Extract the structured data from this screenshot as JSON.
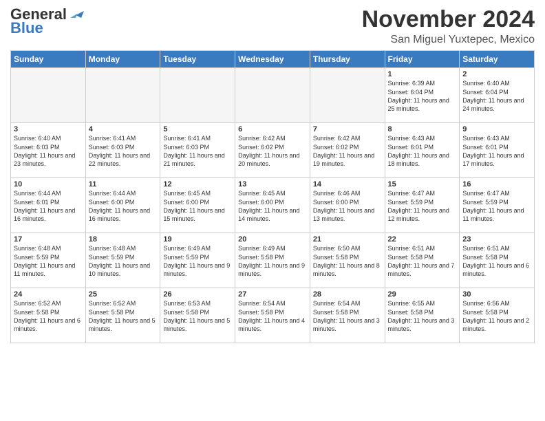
{
  "header": {
    "logo_general": "General",
    "logo_blue": "Blue",
    "month": "November 2024",
    "location": "San Miguel Yuxtepec, Mexico"
  },
  "days_of_week": [
    "Sunday",
    "Monday",
    "Tuesday",
    "Wednesday",
    "Thursday",
    "Friday",
    "Saturday"
  ],
  "weeks": [
    [
      {
        "day": "",
        "empty": true
      },
      {
        "day": "",
        "empty": true
      },
      {
        "day": "",
        "empty": true
      },
      {
        "day": "",
        "empty": true
      },
      {
        "day": "",
        "empty": true
      },
      {
        "day": "1",
        "sunrise": "Sunrise: 6:39 AM",
        "sunset": "Sunset: 6:04 PM",
        "daylight": "Daylight: 11 hours and 25 minutes."
      },
      {
        "day": "2",
        "sunrise": "Sunrise: 6:40 AM",
        "sunset": "Sunset: 6:04 PM",
        "daylight": "Daylight: 11 hours and 24 minutes."
      }
    ],
    [
      {
        "day": "3",
        "sunrise": "Sunrise: 6:40 AM",
        "sunset": "Sunset: 6:03 PM",
        "daylight": "Daylight: 11 hours and 23 minutes."
      },
      {
        "day": "4",
        "sunrise": "Sunrise: 6:41 AM",
        "sunset": "Sunset: 6:03 PM",
        "daylight": "Daylight: 11 hours and 22 minutes."
      },
      {
        "day": "5",
        "sunrise": "Sunrise: 6:41 AM",
        "sunset": "Sunset: 6:03 PM",
        "daylight": "Daylight: 11 hours and 21 minutes."
      },
      {
        "day": "6",
        "sunrise": "Sunrise: 6:42 AM",
        "sunset": "Sunset: 6:02 PM",
        "daylight": "Daylight: 11 hours and 20 minutes."
      },
      {
        "day": "7",
        "sunrise": "Sunrise: 6:42 AM",
        "sunset": "Sunset: 6:02 PM",
        "daylight": "Daylight: 11 hours and 19 minutes."
      },
      {
        "day": "8",
        "sunrise": "Sunrise: 6:43 AM",
        "sunset": "Sunset: 6:01 PM",
        "daylight": "Daylight: 11 hours and 18 minutes."
      },
      {
        "day": "9",
        "sunrise": "Sunrise: 6:43 AM",
        "sunset": "Sunset: 6:01 PM",
        "daylight": "Daylight: 11 hours and 17 minutes."
      }
    ],
    [
      {
        "day": "10",
        "sunrise": "Sunrise: 6:44 AM",
        "sunset": "Sunset: 6:01 PM",
        "daylight": "Daylight: 11 hours and 16 minutes."
      },
      {
        "day": "11",
        "sunrise": "Sunrise: 6:44 AM",
        "sunset": "Sunset: 6:00 PM",
        "daylight": "Daylight: 11 hours and 16 minutes."
      },
      {
        "day": "12",
        "sunrise": "Sunrise: 6:45 AM",
        "sunset": "Sunset: 6:00 PM",
        "daylight": "Daylight: 11 hours and 15 minutes."
      },
      {
        "day": "13",
        "sunrise": "Sunrise: 6:45 AM",
        "sunset": "Sunset: 6:00 PM",
        "daylight": "Daylight: 11 hours and 14 minutes."
      },
      {
        "day": "14",
        "sunrise": "Sunrise: 6:46 AM",
        "sunset": "Sunset: 6:00 PM",
        "daylight": "Daylight: 11 hours and 13 minutes."
      },
      {
        "day": "15",
        "sunrise": "Sunrise: 6:47 AM",
        "sunset": "Sunset: 5:59 PM",
        "daylight": "Daylight: 11 hours and 12 minutes."
      },
      {
        "day": "16",
        "sunrise": "Sunrise: 6:47 AM",
        "sunset": "Sunset: 5:59 PM",
        "daylight": "Daylight: 11 hours and 11 minutes."
      }
    ],
    [
      {
        "day": "17",
        "sunrise": "Sunrise: 6:48 AM",
        "sunset": "Sunset: 5:59 PM",
        "daylight": "Daylight: 11 hours and 11 minutes."
      },
      {
        "day": "18",
        "sunrise": "Sunrise: 6:48 AM",
        "sunset": "Sunset: 5:59 PM",
        "daylight": "Daylight: 11 hours and 10 minutes."
      },
      {
        "day": "19",
        "sunrise": "Sunrise: 6:49 AM",
        "sunset": "Sunset: 5:59 PM",
        "daylight": "Daylight: 11 hours and 9 minutes."
      },
      {
        "day": "20",
        "sunrise": "Sunrise: 6:49 AM",
        "sunset": "Sunset: 5:58 PM",
        "daylight": "Daylight: 11 hours and 9 minutes."
      },
      {
        "day": "21",
        "sunrise": "Sunrise: 6:50 AM",
        "sunset": "Sunset: 5:58 PM",
        "daylight": "Daylight: 11 hours and 8 minutes."
      },
      {
        "day": "22",
        "sunrise": "Sunrise: 6:51 AM",
        "sunset": "Sunset: 5:58 PM",
        "daylight": "Daylight: 11 hours and 7 minutes."
      },
      {
        "day": "23",
        "sunrise": "Sunrise: 6:51 AM",
        "sunset": "Sunset: 5:58 PM",
        "daylight": "Daylight: 11 hours and 6 minutes."
      }
    ],
    [
      {
        "day": "24",
        "sunrise": "Sunrise: 6:52 AM",
        "sunset": "Sunset: 5:58 PM",
        "daylight": "Daylight: 11 hours and 6 minutes."
      },
      {
        "day": "25",
        "sunrise": "Sunrise: 6:52 AM",
        "sunset": "Sunset: 5:58 PM",
        "daylight": "Daylight: 11 hours and 5 minutes."
      },
      {
        "day": "26",
        "sunrise": "Sunrise: 6:53 AM",
        "sunset": "Sunset: 5:58 PM",
        "daylight": "Daylight: 11 hours and 5 minutes."
      },
      {
        "day": "27",
        "sunrise": "Sunrise: 6:54 AM",
        "sunset": "Sunset: 5:58 PM",
        "daylight": "Daylight: 11 hours and 4 minutes."
      },
      {
        "day": "28",
        "sunrise": "Sunrise: 6:54 AM",
        "sunset": "Sunset: 5:58 PM",
        "daylight": "Daylight: 11 hours and 3 minutes."
      },
      {
        "day": "29",
        "sunrise": "Sunrise: 6:55 AM",
        "sunset": "Sunset: 5:58 PM",
        "daylight": "Daylight: 11 hours and 3 minutes."
      },
      {
        "day": "30",
        "sunrise": "Sunrise: 6:56 AM",
        "sunset": "Sunset: 5:58 PM",
        "daylight": "Daylight: 11 hours and 2 minutes."
      }
    ]
  ]
}
